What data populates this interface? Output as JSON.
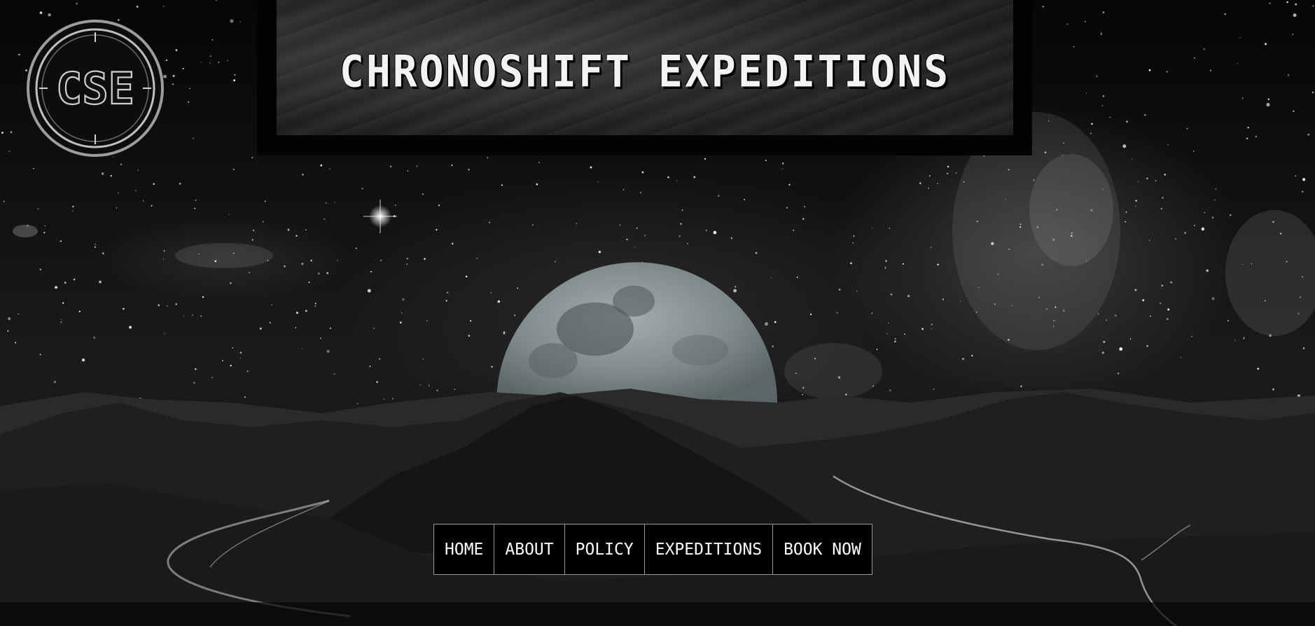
{
  "site": {
    "title": "CHRONOSHIFT EXPEDITIONS",
    "logo_text": "CSE"
  },
  "nav": {
    "items": [
      {
        "label": "HOME"
      },
      {
        "label": "ABOUT"
      },
      {
        "label": "POLICY"
      },
      {
        "label": "EXPEDITIONS"
      },
      {
        "label": "BOOK NOW"
      }
    ]
  },
  "colors": {
    "background": "#050505",
    "text": "#ffffff",
    "nav_border": "#9a9a9a",
    "moon": "#8c9697"
  },
  "icons": {
    "logo": "cse-compass-emblem-icon"
  }
}
